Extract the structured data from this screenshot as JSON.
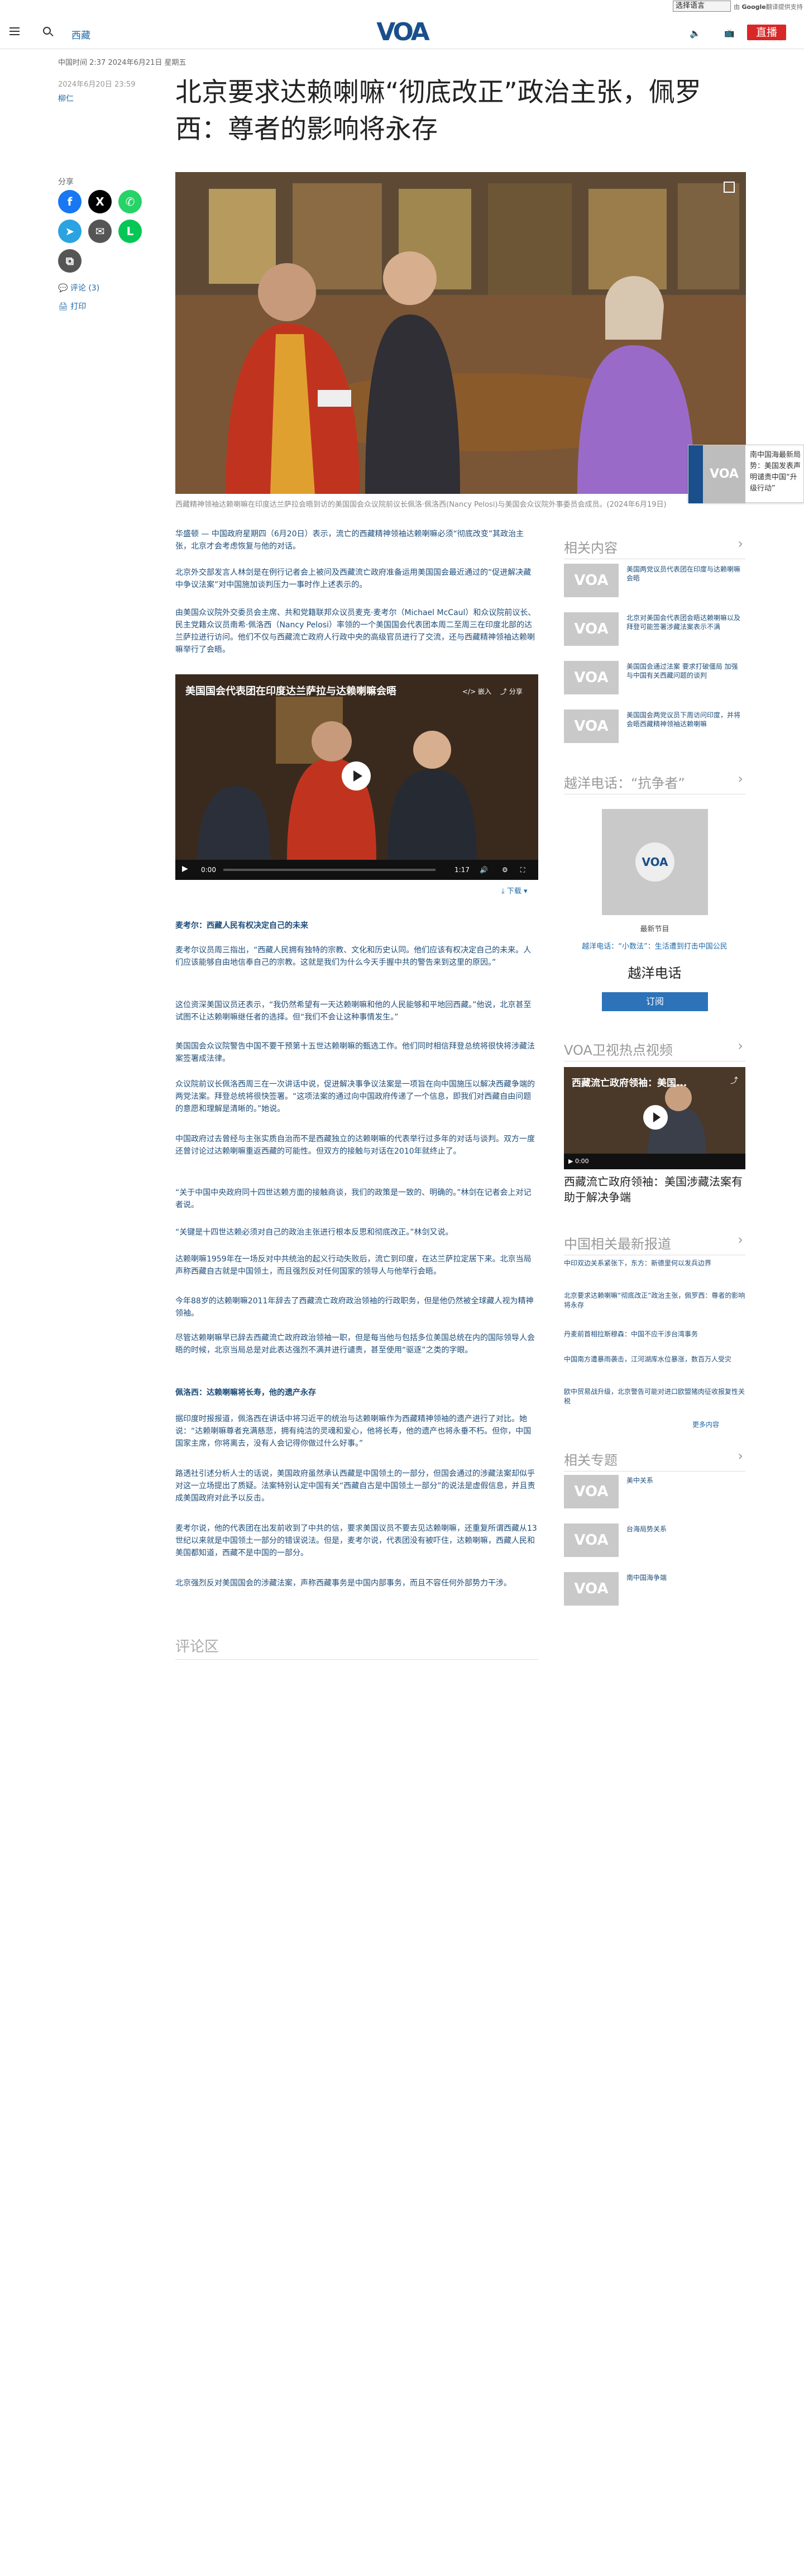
{
  "topbar": {
    "language_select": "选择语言",
    "gt_prefix": "由",
    "gt_brand": "Google",
    "gt_suffix": "翻译提供支持"
  },
  "header": {
    "section": "西藏",
    "logo": "VOA",
    "live_label": "直播"
  },
  "article": {
    "breadcrumb": "中国时间 2:37 2024年6月21日 星期五",
    "date": "2024年6月20日 23:59",
    "author": "柳仁",
    "title": "北京要求达赖喇嘛“彻底改正”政治主张，佩罗西：尊者的影响将永存",
    "share_label": "分享",
    "comments": "评论 (3)",
    "print": "打印",
    "caption": "西藏精神领袖达赖喇嘛在印度达兰萨拉会晤到访的美国国会众议院前议长佩洛·佩洛西(Nancy Pelosi)与美国会众议院外事委员会成员。(2024年6月19日)",
    "paragraphs": [
      "华盛顿 — 中国政府星期四（6月20日）表示，流亡的西藏精神领袖达赖喇嘛必须“彻底改变”其政治主张，北京才会考虑恢复与他的对话。",
      "北京外交部发言人林剑是在例行记者会上被问及西藏流亡政府准备运用美国国会最近通过的“促进解决藏中争议法案”对中国施加谈判压力一事时作上述表示的。",
      "由美国众议院外交委员会主席、共和党籍联邦众议员麦克·麦考尔（Michael McCaul）和众议院前议长、民主党籍众议员南希·佩洛西（Nancy Pelosi）率领的一个美国国会代表团本周二至周三在印度北部的达兰萨拉进行访问。他们不仅与西藏流亡政府人行政中央的高级官员进行了交流，还与西藏精神领袖达赖喇嘛举行了会晤。",
      "麦考尔：西藏人民有权决定自己的未来",
      "麦考尔议员周三指出，“西藏人民拥有独特的宗教、文化和历史认同。他们应该有权决定自己的未来。人们应该能够自由地信奉自己的宗教。这就是我们为什么今天手握中共的警告来到这里的原因。”",
      "这位资深美国议员还表示，“我仍然希望有一天达赖喇嘛和他的人民能够和平地回西藏。”他说，北京甚至试图不让达赖喇嘛继任者的选择。但“我们不会让这种事情发生。”",
      "美国国会众议院警告中国不要干预第十五世达赖喇嘛的甄选工作。他们同时相信拜登总统将很快将涉藏法案签署成法律。",
      "众议院前议长佩洛西周三在一次讲话中说，促进解决事争议法案是一项旨在向中国施压以解决西藏争端的两党法案。拜登总统将很快签署。“这项法案的通过向中国政府传递了一个信息，即我们对西藏自由问题的意愿和理解是清晰的。”她说。",
      "中国政府过去曾经与主张实质自治而不是西藏独立的达赖喇嘛的代表举行过多年的对话与谈判。双方一度还曾讨论过达赖喇嘛重返西藏的可能性。但双方的接触与对话在2010年就终止了。",
      "“关于中国中央政府同十四世达赖方面的接触商谈，我们的政策是一致的、明确的。”林剑在记者会上对记者说。",
      "“关键是十四世达赖必须对自己的政治主张进行根本反思和彻底改正。”林剑又说。",
      "达赖喇嘛1959年在一场反对中共统治的起义行动失败后，流亡到印度，在达兰萨拉定居下来。北京当局声称西藏自古就是中国领土，而且强烈反对任何国家的领导人与他举行会晤。",
      "今年88岁的达赖喇嘛2011年辞去了西藏流亡政府政治领袖的行政职务，但是他仍然被全球藏人视为精神领袖。",
      "尽管达赖喇嘛早已辞去西藏流亡政府政治领袖一职，但是每当他与包括多位美国总统在内的国际领导人会晤的时候，北京当局总是对此表达强烈不满并进行谴责，甚至使用“驱逐”之类的字眼。",
      "佩洛西：达赖喇嘛将长寿，他的遗产永存",
      "据印度时报报道，佩洛西在讲话中将习近平的统治与达赖喇嘛作为西藏精神领袖的遗产进行了对比。她说：“达赖喇嘛尊者充满慈悲，拥有纯洁的灵魂和爱心，他将长寿，他的遗产也将永垂不朽。但你，中国国家主席，你将离去，没有人会记得你做过什么好事。”",
      "路透社引述分析人士的话说，美国政府虽然承认西藏是中国领土的一部分，但国会通过的涉藏法案却似乎对这一立场提出了质疑。法案特别认定中国有关“西藏自古是中国领土一部分”的说法是虚假信息，并且责成美国政府对此予以反击。",
      "麦考尔说，他的代表团在出发前收到了中共的信，要求美国议员不要去见达赖喇嘛，还重复所谓西藏从13世纪以来就是中国领土一部分的错误说法。但是，麦考尔说，代表团没有被吓住，达赖喇嘛，西藏人民和美国都知道，西藏不是中国的一部分。",
      "北京强烈反对美国国会的涉藏法案，声称西藏事务是中国内部事务，而且不容任何外部势力干涉。"
    ],
    "video_title": "美国国会代表团在印度达兰萨拉与达赖喇嘛会晤",
    "video_time_start": "0:00",
    "video_time_end": "1:17",
    "video_share": "分享",
    "video_embed": "嵌入",
    "download": "下载",
    "comment_area": "评论区"
  },
  "side_promo": {
    "text": "南中国海最新局势：美国发表声明谴责中国“升级行动”"
  },
  "rail": {
    "related_title": "相关内容",
    "related": [
      "美国两党议员代表团在印度与达赖喇嘛会晤",
      "北京对美国会代表团会晤达赖喇嘛以及拜登可能签署涉藏法案表示不满",
      "美国国会通过法案 要求打破僵局 加强与中国有关西藏问题的谈判",
      "美国国会两党议员下周访问印度，并将会晤西藏精神领袖达赖喇嘛"
    ],
    "podcast_title": "越洋电话：“抗争者”",
    "podcast_label": "最新节目",
    "podcast_link": "越洋电话：“小数法”：生活遭到打击中国公民",
    "podcast_name": "越洋电话",
    "subscribe": "订阅",
    "video_title": "VOA卫视热点视频",
    "video_overlay": "西藏流亡政府领袖：美国...",
    "video_time": "0:00",
    "video_caption": "西藏流亡政府领袖：美国涉藏法案有助于解决争端",
    "china_title": "中国相关最新报道",
    "china_news": [
      "中印双边关系紧张下，东方：新德里何以发兵边界",
      "北京要求达赖喇嘛“彻底改正”政治主张，佩罗西：尊者的影响将永存",
      "丹麦前首相拉斯穆森：中国不应干涉台湾事务",
      "中国南方遭暴雨袭击，江河湖库水位暴涨，数百万人受灾",
      "欧中贸易战升级，北京警告可能对进口欧盟猪肉征收报复性关税"
    ],
    "more": "更多内容",
    "topics_title": "相关专题",
    "topics": [
      "美中关系",
      "台海局势关系",
      "南中国海争端"
    ]
  }
}
